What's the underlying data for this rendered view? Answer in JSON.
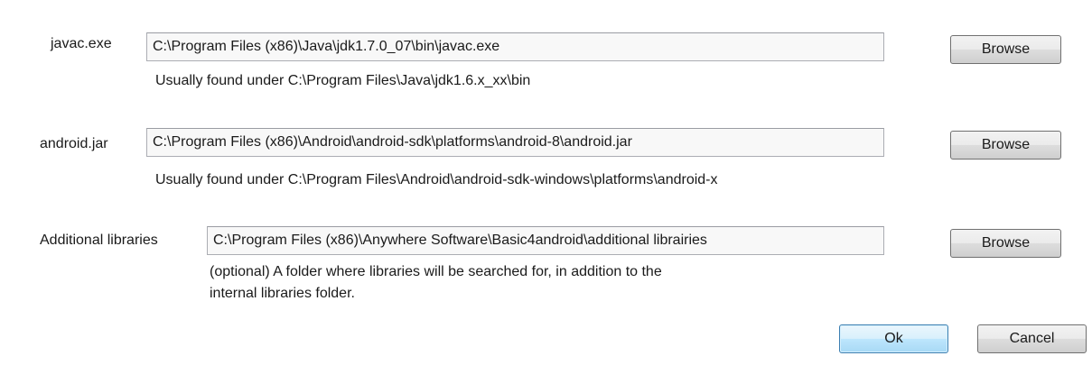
{
  "javac": {
    "label": "javac.exe",
    "value": "C:\\Program Files (x86)\\Java\\jdk1.7.0_07\\bin\\javac.exe",
    "hint": "Usually found under C:\\Program Files\\Java\\jdk1.6.x_xx\\bin",
    "browse_label": "Browse"
  },
  "android_jar": {
    "label": "android.jar",
    "value": "C:\\Program Files (x86)\\Android\\android-sdk\\platforms\\android-8\\android.jar",
    "hint": "Usually found under C:\\Program Files\\Android\\android-sdk-windows\\platforms\\android-x",
    "browse_label": "Browse"
  },
  "additional_libraries": {
    "label": "Additional libraries",
    "value": "C:\\Program Files (x86)\\Anywhere Software\\Basic4android\\additional librairies",
    "hint_line1": "(optional) A folder where libraries will be searched for, in addition to the",
    "hint_line2": "internal libraries folder.",
    "browse_label": "Browse"
  },
  "footer": {
    "ok_label": "Ok",
    "cancel_label": "Cancel"
  }
}
